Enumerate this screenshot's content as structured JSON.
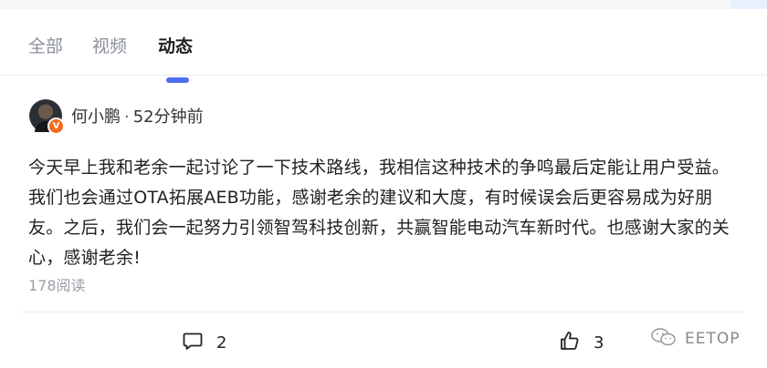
{
  "tabs": [
    {
      "label": "全部",
      "active": false
    },
    {
      "label": "视频",
      "active": false
    },
    {
      "label": "动态",
      "active": true
    }
  ],
  "post": {
    "author": "何小鹏",
    "separator": "·",
    "time": "52分钟前",
    "verified_badge": "V",
    "text": "今天早上我和老余一起讨论了一下技术路线，我相信这种技术的争鸣最后定能让用户受益。我们也会通过OTA拓展AEB功能，感谢老余的建议和大度，有时候误会后更容易成为好朋友。之后，我们会一起努力引领智驾科技创新，共赢智能电动汽车新时代。也感谢大家的关心，感谢老余!",
    "read_count": "178阅读",
    "comment_count": "2",
    "like_count": "3"
  },
  "watermark": {
    "text": "EETOP"
  },
  "colors": {
    "accent": "#4e6ef2",
    "badge": "#f26a1b",
    "muted": "#9a9ea6"
  },
  "icons": {
    "comment": "comment-bubble-icon",
    "like": "thumbs-up-icon",
    "watermark": "wechat-icon"
  }
}
